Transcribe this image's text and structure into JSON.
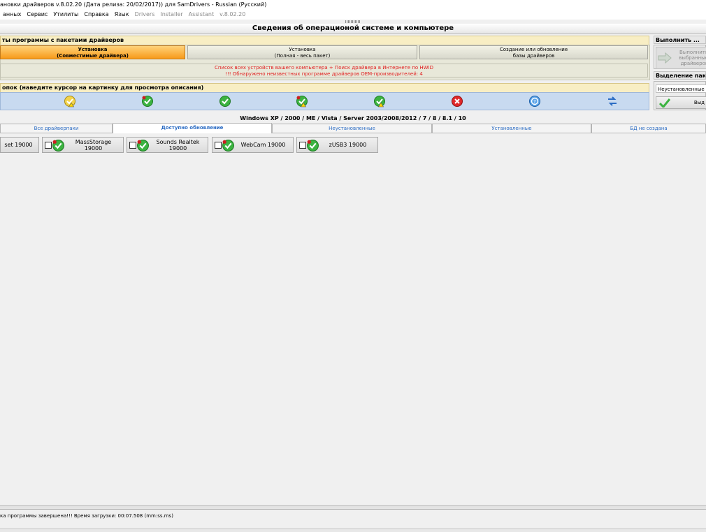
{
  "window": {
    "title": "ановки драйверов v.8.02.20 (Дата релиза: 20/02/2017)) для SamDrivers - Russian (Русский)"
  },
  "menu": {
    "items": [
      {
        "label": "анных",
        "dim": false
      },
      {
        "label": "Сервис",
        "dim": false
      },
      {
        "label": "Утилиты",
        "dim": false
      },
      {
        "label": "Справка",
        "dim": false
      },
      {
        "label": "Язык",
        "dim": false
      },
      {
        "label": "Drivers",
        "dim": true
      },
      {
        "label": "Installer",
        "dim": true
      },
      {
        "label": "Assistant",
        "dim": true
      },
      {
        "label": "v.8.02.20",
        "dim": true
      }
    ]
  },
  "header": {
    "title": "Сведения об операционой системе и компьютере"
  },
  "modes_panel": {
    "title": "ты программы с пакетами драйверов",
    "buttons": [
      {
        "line1": "Установка",
        "line2": "(Совместимые драйвера)"
      },
      {
        "line1": "Установка",
        "line2": "(Полная - весь пакет)"
      },
      {
        "line1": "Создание или обновление",
        "line2": "базы драйверов"
      }
    ],
    "info_line1": "Список всех устройств вашего компьютера + Поиск драйвера в Интернете по HWID",
    "info_line2": "!!! Обнаружено неизвестных программе драйверов OEM-производителей: 4"
  },
  "filters_panel": {
    "title": "опок (наведите курсор на картинку для просмотра описания)",
    "icons": [
      "folder-warning-icon",
      "check-new-icon",
      "check-icon",
      "check-warning-icon",
      "check-warning-icon",
      "error-icon",
      "help-icon",
      "refresh-icon"
    ]
  },
  "right_panel": {
    "run_title": "Выполнить ...",
    "run_button": [
      "Выполнить",
      "выбранные",
      "драйверов"
    ],
    "select_title": "Выделение пакето",
    "select_value": "Неустановленные",
    "select_button": "Выд"
  },
  "os_label": "Windows XP / 2000 / ME / Vista / Server 2003/2008/2012 / 7 / 8 / 8.1 / 10",
  "tabs": [
    {
      "label": "Все драйверпаки"
    },
    {
      "label": "Доступно обновление"
    },
    {
      "label": "Неустановленные"
    },
    {
      "label": "Установленные"
    },
    {
      "label": "БД не создана"
    }
  ],
  "driver_packs": [
    {
      "label": "set 19000"
    },
    {
      "label": "MassStorage 19000"
    },
    {
      "label": "Sounds Realtek 19000"
    },
    {
      "label": "WebCam 19000"
    },
    {
      "label": "zUSB3 19000"
    }
  ],
  "status": {
    "text": "ка программы завершена!!! Время загрузки: 00:07.508 (mm:ss.ms)"
  },
  "colors": {
    "accent": "#f79a1a",
    "panel_title": "#f8eec4",
    "icon_row": "#c8daf0",
    "tab_text": "#2b6cc4",
    "warn_text": "#e02020"
  }
}
